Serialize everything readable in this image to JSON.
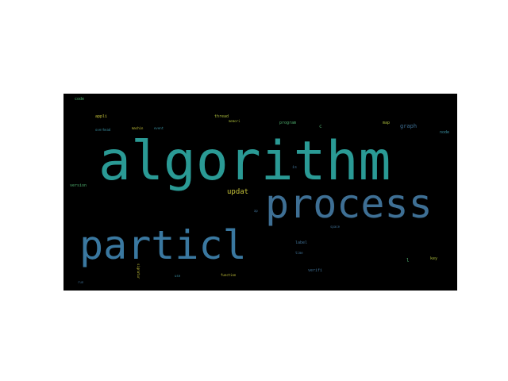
{
  "colors": {
    "page_background": "#ffffff",
    "cloud_background": "#000000",
    "palette": [
      "#2a9a95",
      "#3e6f94",
      "#3a8fa0",
      "#a7b83a",
      "#c7c43a",
      "#4fae6e",
      "#5b4f8f"
    ]
  },
  "words": {
    "algorithm": "algorithm",
    "process": "process",
    "particl": "particl",
    "updat": "updat",
    "graph": "graph",
    "code": "code",
    "appli": "appli",
    "thread": "thread",
    "memori": "memori",
    "program": "program",
    "map": "map",
    "node": "node",
    "overhead": "overhead",
    "machin": "machin",
    "event": "event",
    "version": "version",
    "is": "is",
    "label": "label",
    "space": "space",
    "time": "time",
    "key": "key",
    "verifi": "verifi",
    "run": "run",
    "signatur": "signatur",
    "use": "use",
    "function": "function",
    "ap": "ap",
    "c": "c",
    "l": "l"
  }
}
